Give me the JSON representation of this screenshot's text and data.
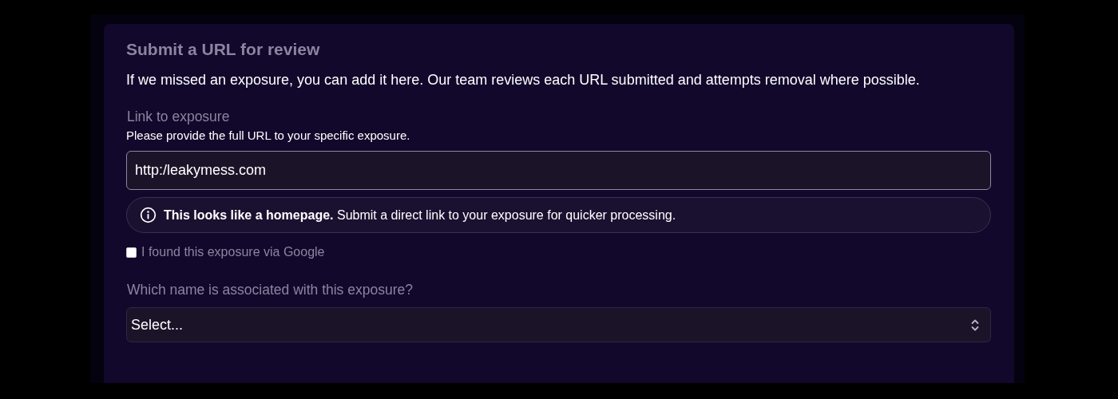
{
  "title": "Submit a URL for review",
  "description": "If we missed an exposure, you can add it here. Our team reviews each URL submitted and attempts removal where possible.",
  "url_field": {
    "label": "Link to exposure",
    "helper": "Please provide the full URL to your specific exposure.",
    "value": "http:/leakymess.com"
  },
  "notice": {
    "text": "**This looks like a homepage.** Submit a direct link to your exposure for quicker processing."
  },
  "checkbox": {
    "label": "I found this exposure via Google",
    "checked": false
  },
  "name_select": {
    "label": "Which name is associated with this exposure?",
    "value": "Select..."
  }
}
